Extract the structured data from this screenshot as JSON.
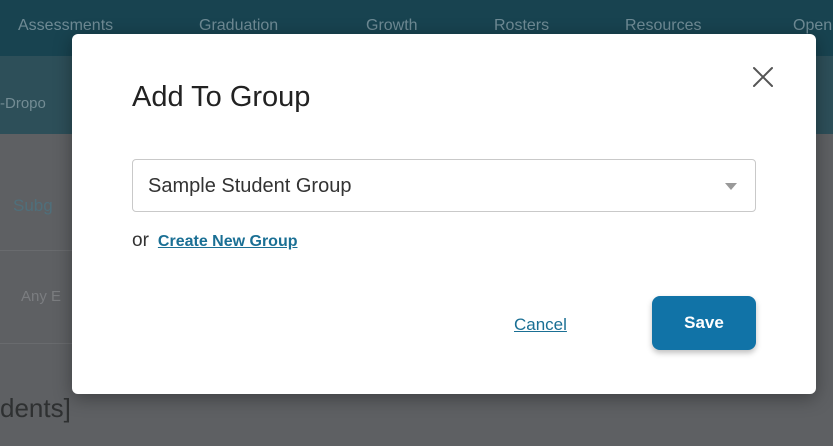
{
  "background": {
    "nav_items": [
      "Assessments",
      "Graduation",
      "Growth",
      "Rosters",
      "Resources",
      "Open"
    ],
    "subnav_text": "-Dropo",
    "subgroup_text": "Subg",
    "any_text": "Any E",
    "students_text": "dents]"
  },
  "modal": {
    "title": "Add To Group",
    "select_value": "Sample Student Group",
    "or_text": "or",
    "create_link": "Create New Group",
    "cancel_label": "Cancel",
    "save_label": "Save"
  },
  "colors": {
    "primary": "#1173a7",
    "link": "#1a6f94"
  }
}
